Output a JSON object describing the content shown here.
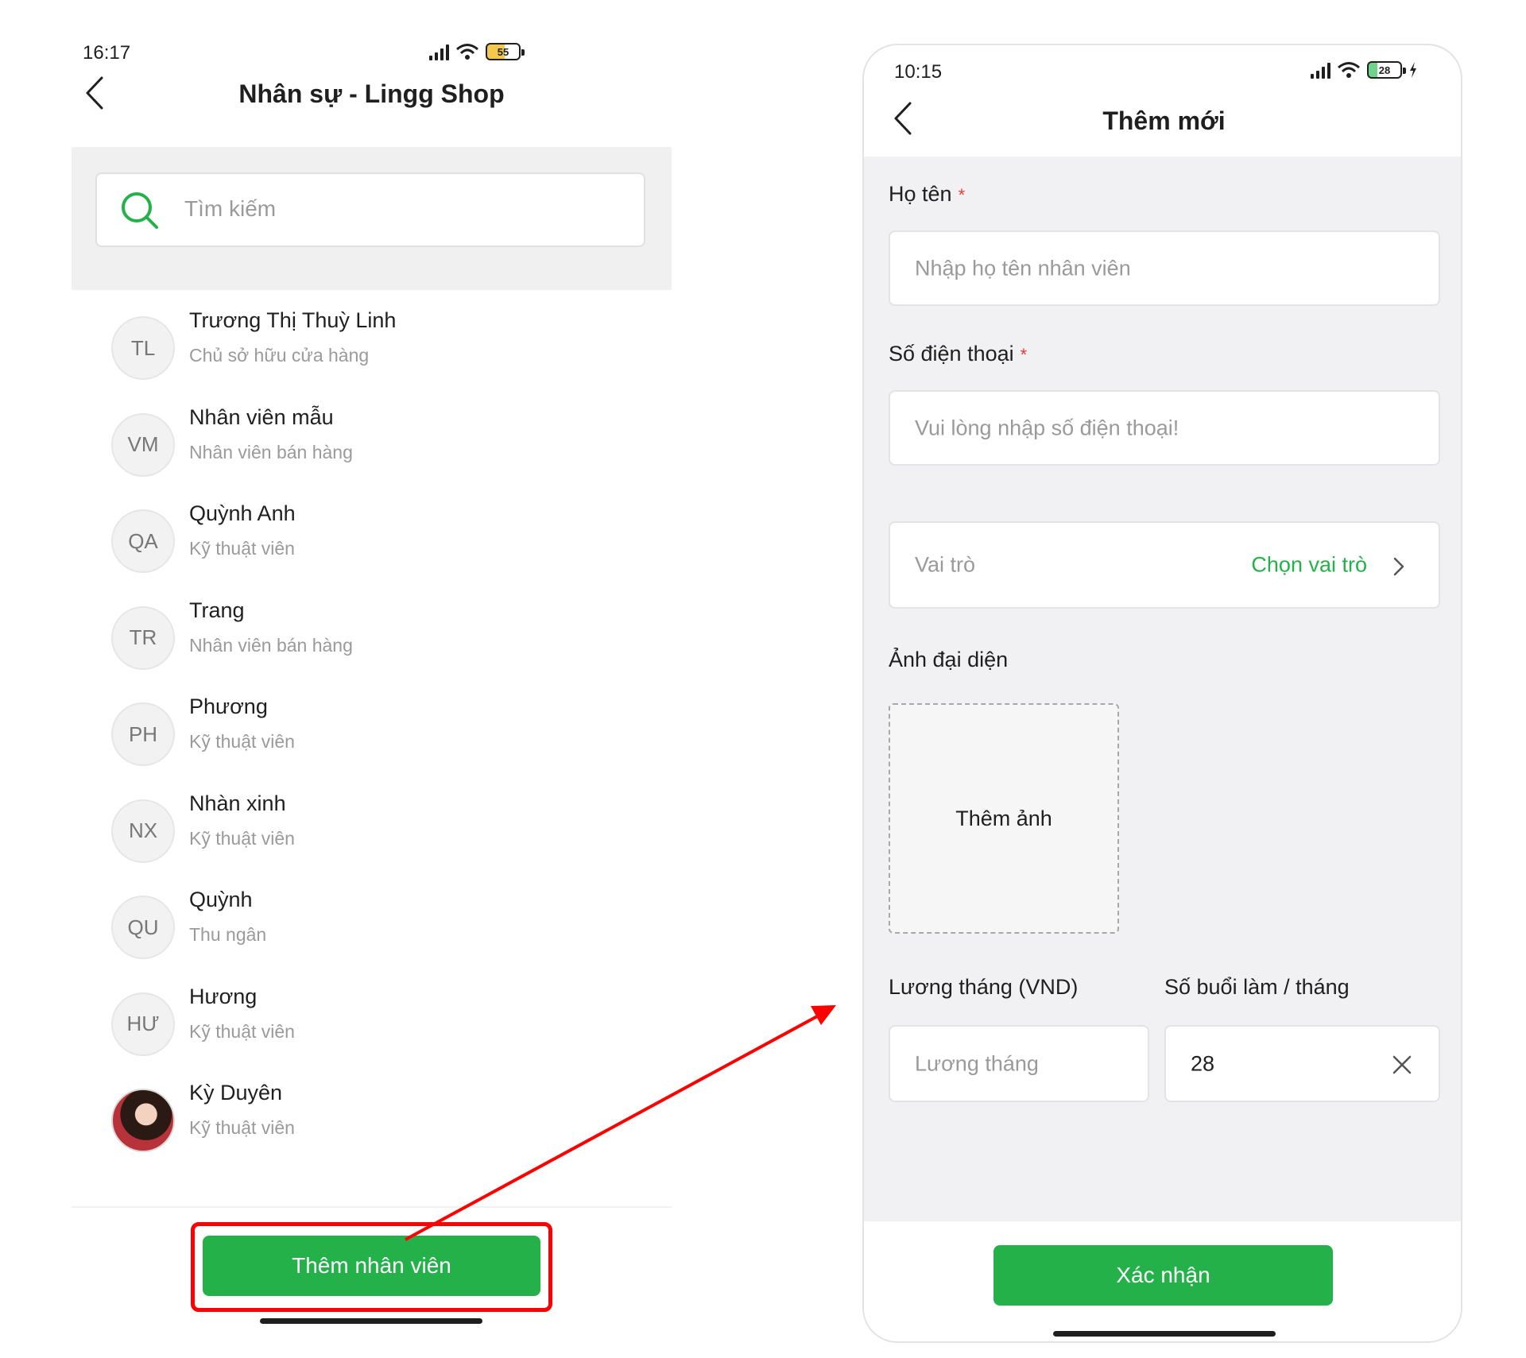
{
  "left_screen": {
    "status_time": "16:17",
    "battery_level": "55",
    "title": "Nhân sự - Lingg Shop",
    "search_placeholder": "Tìm kiếm",
    "staff": [
      {
        "initials": "TL",
        "name": "Trương Thị Thuỳ Linh",
        "role": "Chủ sở hữu cửa hàng"
      },
      {
        "initials": "VM",
        "name": "Nhân viên mẫu",
        "role": "Nhân viên bán hàng"
      },
      {
        "initials": "QA",
        "name": "Quỳnh Anh",
        "role": "Kỹ thuật viên"
      },
      {
        "initials": "TR",
        "name": "Trang",
        "role": "Nhân viên bán hàng"
      },
      {
        "initials": "PH",
        "name": "Phương",
        "role": "Kỹ thuật viên"
      },
      {
        "initials": "NX",
        "name": "Nhàn xinh",
        "role": "Kỹ thuật viên"
      },
      {
        "initials": "QU",
        "name": "Quỳnh",
        "role": "Thu ngân"
      },
      {
        "initials": "HƯ",
        "name": "Hương",
        "role": "Kỹ thuật viên"
      },
      {
        "initials": "",
        "name": "Kỳ Duyên",
        "role": "Kỹ thuật viên"
      }
    ],
    "add_button_label": "Thêm nhân viên"
  },
  "right_screen": {
    "status_time": "10:15",
    "battery_level": "28",
    "title": "Thêm mới",
    "name_label": "Họ tên",
    "name_placeholder": "Nhập họ tên nhân viên",
    "phone_label": "Số điện thoại",
    "phone_placeholder": "Vui lòng nhập số điện thoại!",
    "role_label": "Vai trò",
    "role_select": "Chọn vai trò",
    "avatar_label": "Ảnh đại diện",
    "avatar_upload": "Thêm ảnh",
    "salary_label": "Lương tháng (VND)",
    "salary_placeholder": "Lương tháng",
    "sessions_label": "Số buổi làm / tháng",
    "sessions_value": "28",
    "required_mark": "*",
    "confirm_label": "Xác nhận"
  },
  "colors": {
    "brand_green": "#25b14a",
    "annotation_red": "#ff0000",
    "required_red": "#e53935"
  },
  "icons": [
    "back-icon",
    "search-icon",
    "signal-icon",
    "wifi-icon",
    "battery-icon",
    "charging-icon",
    "chevron-right-icon",
    "clear-icon"
  ]
}
